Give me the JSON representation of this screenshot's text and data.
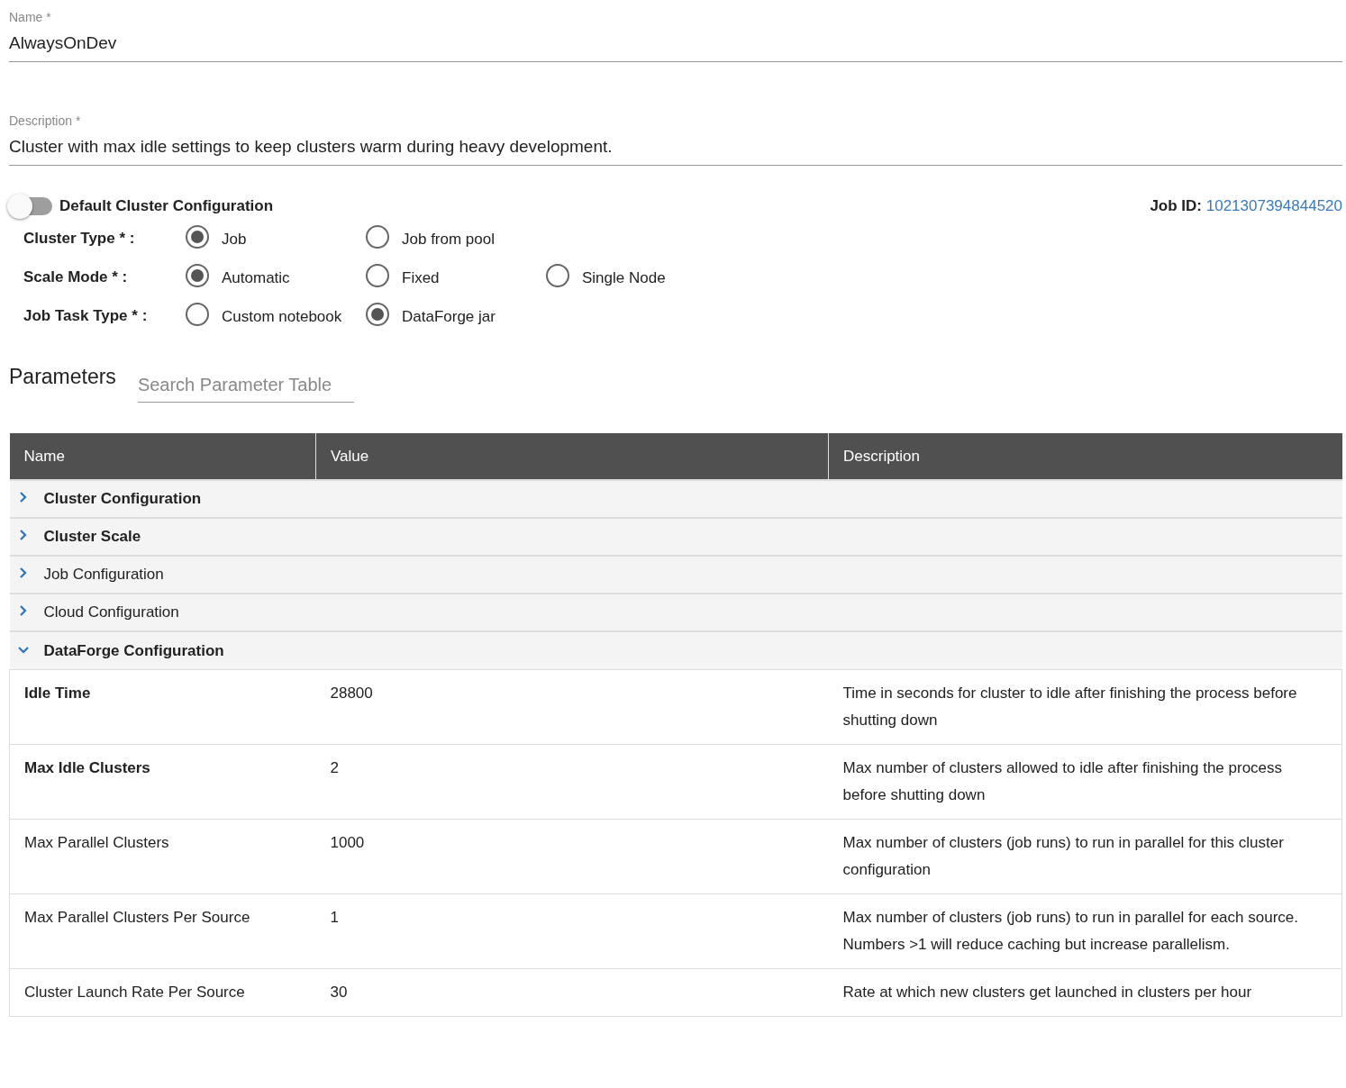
{
  "fields": [
    {
      "label": "Name *",
      "value": "AlwaysOnDev"
    },
    {
      "label": "Description *",
      "value": "Cluster with max idle settings to keep clusters warm during heavy development."
    }
  ],
  "default_toggle": {
    "label": "Default Cluster Configuration",
    "on": false
  },
  "job_id": {
    "label": "Job ID:",
    "value": "1021307394844520"
  },
  "radio_groups": [
    {
      "label": "Cluster Type * :",
      "options": [
        {
          "label": "Job",
          "selected": true
        },
        {
          "label": "Job from pool",
          "selected": false
        }
      ]
    },
    {
      "label": "Scale Mode * :",
      "options": [
        {
          "label": "Automatic",
          "selected": true
        },
        {
          "label": "Fixed",
          "selected": false
        },
        {
          "label": "Single Node",
          "selected": false
        }
      ]
    },
    {
      "label": "Job Task Type * :",
      "options": [
        {
          "label": "Custom notebook",
          "selected": false
        },
        {
          "label": "DataForge jar",
          "selected": true
        }
      ]
    }
  ],
  "parameters": {
    "title": "Parameters",
    "search": {
      "placeholder": "Search Parameter Table"
    },
    "columns": [
      "Name",
      "Value",
      "Description"
    ],
    "groups": [
      {
        "name": "Cluster Configuration",
        "bold": true,
        "expanded": false
      },
      {
        "name": "Cluster Scale",
        "bold": true,
        "expanded": false
      },
      {
        "name": "Job Configuration",
        "bold": false,
        "expanded": false
      },
      {
        "name": "Cloud Configuration",
        "bold": false,
        "expanded": false
      },
      {
        "name": "DataForge Configuration",
        "bold": true,
        "expanded": true,
        "rows": [
          {
            "name": "Idle Time",
            "bold": true,
            "value": "28800",
            "description": "Time in seconds for cluster to idle after finishing the process before shutting down"
          },
          {
            "name": "Max Idle Clusters",
            "bold": true,
            "value": "2",
            "description": "Max number of clusters allowed to idle after finishing the process before shutting down"
          },
          {
            "name": "Max Parallel Clusters",
            "bold": false,
            "value": "1000",
            "description": "Max number of clusters (job runs) to run in parallel for this cluster configuration"
          },
          {
            "name": "Max Parallel Clusters Per Source",
            "bold": false,
            "value": "1",
            "description": "Max number of clusters (job runs) to run in parallel for each source. Numbers >1 will reduce caching but increase parallelism."
          },
          {
            "name": "Cluster Launch Rate Per Source",
            "bold": false,
            "value": "30",
            "description": "Rate at which new clusters get launched in clusters per hour"
          }
        ]
      }
    ]
  }
}
